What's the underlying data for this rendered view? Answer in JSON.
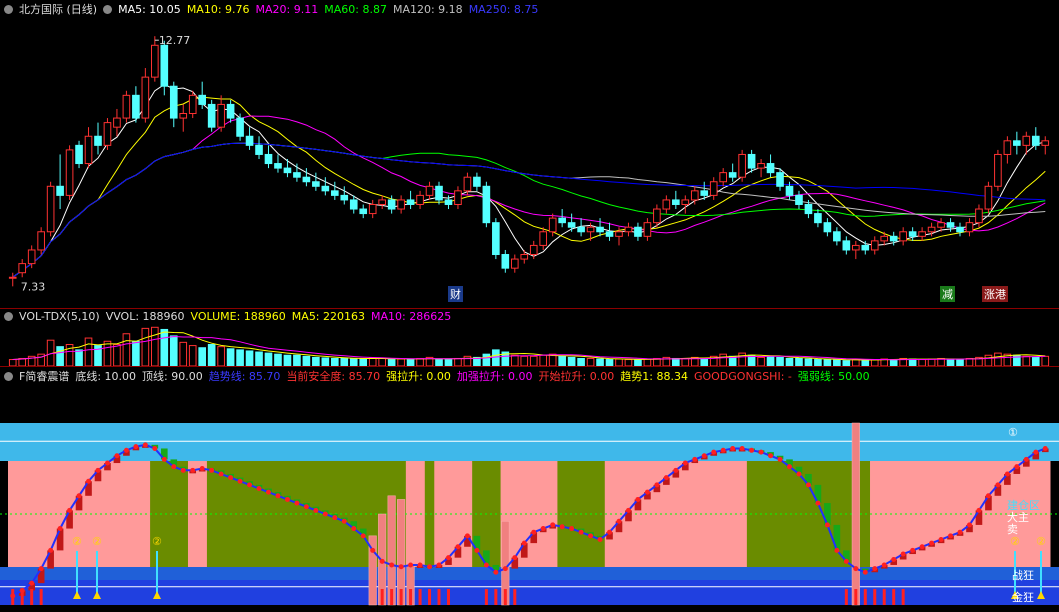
{
  "colors": {
    "up": "#ff3232",
    "down": "#54ffff",
    "ma5": "#ffffff",
    "ma10": "#ffff00",
    "ma20": "#ff00ff",
    "ma60": "#00ff00",
    "ma120": "#c0c0c0",
    "ma250": "#0000ff"
  },
  "price_panel": {
    "title": "北方国际 (日线)",
    "ma": [
      {
        "label": "MA5:",
        "value": "10.05",
        "color": "#ffffff"
      },
      {
        "label": "MA10:",
        "value": "9.76",
        "color": "#ffff00"
      },
      {
        "label": "MA20:",
        "value": "9.11",
        "color": "#ff00ff"
      },
      {
        "label": "MA60:",
        "value": "8.87",
        "color": "#00ff00"
      },
      {
        "label": "MA120:",
        "value": "9.18",
        "color": "#c0c0c0"
      },
      {
        "label": "MA250:",
        "value": "8.75",
        "color": "#3a3aff"
      }
    ],
    "high_label": "12.77",
    "low_label": "7.33",
    "markers": [
      {
        "text": "财",
        "color": "#ffffff",
        "bg": "#1a3a8a"
      },
      {
        "text": "减",
        "color": "#ffffff",
        "bg": "#1a7a1a"
      },
      {
        "text": "涨港",
        "color": "#ffffff",
        "bg": "#8a1a1a"
      }
    ]
  },
  "volume_panel": {
    "name": "VOL-TDX(5,10)",
    "items": [
      {
        "label": "VVOL:",
        "value": "188960",
        "color": "#dddddd"
      },
      {
        "label": "VOLUME:",
        "value": "188960",
        "color": "#ffff00"
      },
      {
        "label": "MA5:",
        "value": "220163",
        "color": "#ffff00"
      },
      {
        "label": "MA10:",
        "value": "286625",
        "color": "#ff00ff"
      }
    ]
  },
  "indicator_panel": {
    "name": "F简睿震谱",
    "items": [
      {
        "label": "底线:",
        "value": "10.00",
        "color": "#dddddd"
      },
      {
        "label": "顶线:",
        "value": "90.00",
        "color": "#dddddd"
      },
      {
        "label": "趋势线:",
        "value": "85.70",
        "color": "#3a3aff"
      },
      {
        "label": "当前安全度:",
        "value": "85.70",
        "color": "#ff3232"
      },
      {
        "label": "强拉升:",
        "value": "0.00",
        "color": "#ffff00"
      },
      {
        "label": "加强拉升:",
        "value": "0.00",
        "color": "#ff00ff"
      },
      {
        "label": "开始拉升:",
        "value": "0.00",
        "color": "#ff3232"
      },
      {
        "label": "趋势1:",
        "value": "88.34",
        "color": "#ffff00"
      },
      {
        "label": "GOODGONGSHI:",
        "value": "-",
        "color": "#ff3232"
      },
      {
        "label": "强弱线:",
        "value": "50.00",
        "color": "#00ff00"
      }
    ],
    "labels": {
      "circle1": "①",
      "circle2": "②",
      "zone": "建仓区",
      "main": "大主",
      "sell": "卖",
      "zhan": "战狂",
      "jin": "金狂"
    }
  },
  "chart_data": [
    {
      "type": "candlestick",
      "title": "北方国际 (日线)",
      "ylim": [
        7.0,
        13.2
      ],
      "annotations": [
        {
          "text": "12.77",
          "kind": "high"
        },
        {
          "text": "7.33",
          "kind": "low"
        }
      ],
      "candles": [
        [
          7.5,
          7.6,
          7.3,
          7.5
        ],
        [
          7.6,
          7.9,
          7.5,
          7.8
        ],
        [
          7.8,
          8.2,
          7.7,
          8.1
        ],
        [
          8.1,
          8.6,
          8.0,
          8.5
        ],
        [
          8.5,
          9.6,
          8.4,
          9.5
        ],
        [
          9.5,
          10.2,
          9.0,
          9.3
        ],
        [
          9.3,
          10.4,
          9.2,
          10.3
        ],
        [
          10.4,
          10.5,
          9.9,
          10.0
        ],
        [
          10.0,
          10.8,
          9.9,
          10.6
        ],
        [
          10.6,
          10.9,
          10.2,
          10.4
        ],
        [
          10.4,
          11.0,
          10.3,
          10.9
        ],
        [
          10.8,
          11.2,
          10.6,
          11.0
        ],
        [
          11.0,
          11.6,
          10.9,
          11.5
        ],
        [
          11.5,
          11.7,
          10.9,
          11.0
        ],
        [
          11.0,
          12.1,
          10.9,
          11.9
        ],
        [
          11.9,
          12.8,
          11.8,
          12.6
        ],
        [
          12.6,
          12.7,
          11.5,
          11.7
        ],
        [
          11.7,
          11.8,
          10.8,
          11.0
        ],
        [
          11.0,
          11.3,
          10.7,
          11.1
        ],
        [
          11.1,
          11.6,
          11.0,
          11.5
        ],
        [
          11.5,
          11.8,
          11.2,
          11.3
        ],
        [
          11.3,
          11.4,
          10.7,
          10.8
        ],
        [
          10.8,
          11.5,
          10.7,
          11.3
        ],
        [
          11.3,
          11.4,
          10.9,
          11.0
        ],
        [
          11.0,
          11.1,
          10.5,
          10.6
        ],
        [
          10.6,
          10.8,
          10.3,
          10.4
        ],
        [
          10.4,
          10.6,
          10.1,
          10.2
        ],
        [
          10.2,
          10.4,
          9.9,
          10.0
        ],
        [
          10.0,
          10.2,
          9.8,
          9.9
        ],
        [
          9.9,
          10.1,
          9.7,
          9.8
        ],
        [
          9.8,
          10.0,
          9.6,
          9.7
        ],
        [
          9.7,
          9.9,
          9.5,
          9.6
        ],
        [
          9.6,
          9.8,
          9.4,
          9.5
        ],
        [
          9.5,
          9.7,
          9.3,
          9.4
        ],
        [
          9.4,
          9.6,
          9.2,
          9.3
        ],
        [
          9.3,
          9.5,
          9.1,
          9.2
        ],
        [
          9.2,
          9.3,
          8.9,
          9.0
        ],
        [
          9.0,
          9.1,
          8.8,
          8.9
        ],
        [
          8.9,
          9.2,
          8.8,
          9.1
        ],
        [
          9.1,
          9.3,
          9.0,
          9.2
        ],
        [
          9.2,
          9.3,
          8.9,
          9.0
        ],
        [
          9.0,
          9.3,
          8.9,
          9.2
        ],
        [
          9.2,
          9.4,
          9.0,
          9.1
        ],
        [
          9.1,
          9.4,
          9.0,
          9.3
        ],
        [
          9.3,
          9.6,
          9.2,
          9.5
        ],
        [
          9.5,
          9.6,
          9.1,
          9.2
        ],
        [
          9.2,
          9.3,
          9.0,
          9.1
        ],
        [
          9.1,
          9.5,
          9.0,
          9.4
        ],
        [
          9.4,
          9.8,
          9.3,
          9.7
        ],
        [
          9.7,
          9.8,
          9.4,
          9.5
        ],
        [
          9.5,
          9.6,
          8.6,
          8.7
        ],
        [
          8.7,
          8.8,
          7.9,
          8.0
        ],
        [
          8.0,
          8.1,
          7.6,
          7.7
        ],
        [
          7.7,
          8.0,
          7.6,
          7.9
        ],
        [
          7.9,
          8.1,
          7.8,
          8.0
        ],
        [
          8.0,
          8.3,
          7.9,
          8.2
        ],
        [
          8.2,
          8.6,
          8.1,
          8.5
        ],
        [
          8.5,
          8.9,
          8.4,
          8.8
        ],
        [
          8.8,
          9.0,
          8.6,
          8.7
        ],
        [
          8.7,
          8.9,
          8.5,
          8.6
        ],
        [
          8.6,
          8.8,
          8.4,
          8.5
        ],
        [
          8.5,
          8.7,
          8.3,
          8.6
        ],
        [
          8.6,
          8.8,
          8.4,
          8.5
        ],
        [
          8.5,
          8.7,
          8.3,
          8.4
        ],
        [
          8.4,
          8.6,
          8.2,
          8.5
        ],
        [
          8.5,
          8.7,
          8.4,
          8.6
        ],
        [
          8.6,
          8.7,
          8.3,
          8.4
        ],
        [
          8.4,
          8.8,
          8.3,
          8.7
        ],
        [
          8.7,
          9.1,
          8.6,
          9.0
        ],
        [
          9.0,
          9.3,
          8.9,
          9.2
        ],
        [
          9.2,
          9.4,
          9.0,
          9.1
        ],
        [
          9.1,
          9.3,
          8.9,
          9.2
        ],
        [
          9.2,
          9.5,
          9.1,
          9.4
        ],
        [
          9.4,
          9.6,
          9.2,
          9.3
        ],
        [
          9.3,
          9.7,
          9.2,
          9.6
        ],
        [
          9.6,
          9.9,
          9.5,
          9.8
        ],
        [
          9.8,
          10.0,
          9.6,
          9.7
        ],
        [
          9.7,
          10.3,
          9.6,
          10.2
        ],
        [
          10.2,
          10.3,
          9.8,
          9.9
        ],
        [
          9.9,
          10.1,
          9.7,
          10.0
        ],
        [
          10.0,
          10.2,
          9.7,
          9.8
        ],
        [
          9.8,
          9.9,
          9.4,
          9.5
        ],
        [
          9.5,
          9.6,
          9.2,
          9.3
        ],
        [
          9.3,
          9.4,
          9.0,
          9.1
        ],
        [
          9.1,
          9.2,
          8.8,
          8.9
        ],
        [
          8.9,
          9.0,
          8.6,
          8.7
        ],
        [
          8.7,
          8.8,
          8.4,
          8.5
        ],
        [
          8.5,
          8.6,
          8.2,
          8.3
        ],
        [
          8.3,
          8.4,
          8.0,
          8.1
        ],
        [
          8.1,
          8.3,
          7.9,
          8.2
        ],
        [
          8.2,
          8.3,
          8.0,
          8.1
        ],
        [
          8.1,
          8.4,
          8.0,
          8.3
        ],
        [
          8.3,
          8.5,
          8.2,
          8.4
        ],
        [
          8.4,
          8.5,
          8.2,
          8.3
        ],
        [
          8.3,
          8.6,
          8.2,
          8.5
        ],
        [
          8.5,
          8.6,
          8.3,
          8.4
        ],
        [
          8.4,
          8.6,
          8.3,
          8.5
        ],
        [
          8.5,
          8.7,
          8.4,
          8.6
        ],
        [
          8.6,
          8.8,
          8.5,
          8.7
        ],
        [
          8.7,
          8.8,
          8.5,
          8.6
        ],
        [
          8.6,
          8.7,
          8.4,
          8.5
        ],
        [
          8.5,
          8.8,
          8.4,
          8.7
        ],
        [
          8.7,
          9.1,
          8.6,
          9.0
        ],
        [
          9.0,
          9.6,
          8.9,
          9.5
        ],
        [
          9.5,
          10.3,
          9.4,
          10.2
        ],
        [
          10.2,
          10.6,
          10.0,
          10.5
        ],
        [
          10.5,
          10.7,
          10.2,
          10.4
        ],
        [
          10.4,
          10.7,
          10.2,
          10.6
        ],
        [
          10.6,
          10.8,
          10.3,
          10.4
        ],
        [
          10.4,
          10.6,
          10.2,
          10.5
        ]
      ]
    },
    {
      "type": "bar",
      "title": "VOL-TDX(5,10)",
      "series": [
        {
          "name": "VOLUME",
          "values": [
            12,
            14,
            18,
            22,
            48,
            36,
            40,
            30,
            52,
            38,
            46,
            40,
            60,
            46,
            70,
            72,
            68,
            56,
            44,
            38,
            34,
            40,
            36,
            32,
            30,
            28,
            26,
            24,
            22,
            20,
            20,
            18,
            16,
            15,
            14,
            14,
            14,
            13,
            15,
            14,
            12,
            13,
            12,
            14,
            16,
            13,
            12,
            14,
            18,
            16,
            22,
            30,
            26,
            20,
            18,
            18,
            20,
            22,
            18,
            16,
            14,
            14,
            13,
            12,
            13,
            12,
            11,
            13,
            14,
            16,
            14,
            14,
            16,
            14,
            18,
            22,
            18,
            24,
            20,
            16,
            18,
            16,
            14,
            14,
            13,
            12,
            12,
            11,
            10,
            12,
            11,
            12,
            13,
            12,
            14,
            13,
            12,
            13,
            14,
            13,
            12,
            14,
            16,
            20,
            24,
            22,
            20,
            18,
            16,
            18
          ]
        }
      ],
      "ylim": [
        0,
        80
      ]
    },
    {
      "type": "line",
      "title": "F简睿震谱",
      "ylim": [
        0,
        100
      ],
      "series": [
        {
          "name": "当前安全度",
          "values": [
            5,
            8,
            12,
            20,
            30,
            42,
            52,
            60,
            68,
            74,
            78,
            82,
            85,
            87,
            88,
            86,
            80,
            76,
            74,
            74,
            75,
            74,
            72,
            70,
            68,
            66,
            64,
            62,
            60,
            58,
            56,
            54,
            52,
            50,
            48,
            46,
            42,
            38,
            30,
            24,
            22,
            21,
            22,
            22,
            21,
            22,
            26,
            32,
            38,
            30,
            22,
            18,
            20,
            26,
            34,
            40,
            42,
            44,
            43,
            42,
            40,
            38,
            36,
            40,
            46,
            52,
            58,
            62,
            66,
            70,
            74,
            78,
            80,
            82,
            84,
            85,
            86,
            86,
            85,
            84,
            82,
            80,
            76,
            72,
            66,
            56,
            44,
            30,
            24,
            20,
            18,
            20,
            22,
            25,
            28,
            30,
            32,
            34,
            36,
            38,
            40,
            44,
            52,
            60,
            66,
            72,
            76,
            80,
            84,
            86
          ]
        },
        {
          "name": "强拉升",
          "values": [
            0,
            0,
            0,
            0,
            0,
            0,
            0,
            0,
            0,
            0,
            0,
            0,
            0,
            0,
            0,
            0,
            0,
            0,
            0,
            0,
            0,
            0,
            0,
            0,
            0,
            0,
            0,
            0,
            0,
            0,
            0,
            0,
            0,
            0,
            0,
            0,
            0,
            0,
            38,
            50,
            60,
            58,
            22,
            0,
            0,
            0,
            0,
            0,
            0,
            0,
            0,
            0,
            46,
            0,
            0,
            0,
            0,
            0,
            0,
            0,
            0,
            0,
            0,
            0,
            0,
            0,
            0,
            0,
            0,
            0,
            0,
            0,
            0,
            0,
            0,
            0,
            0,
            0,
            0,
            0,
            0,
            0,
            0,
            0,
            0,
            0,
            0,
            0,
            0,
            100,
            0,
            0,
            0,
            0,
            0,
            0,
            0,
            0,
            0,
            0,
            0,
            0,
            0,
            0,
            0,
            0,
            0,
            0,
            0,
            0
          ]
        },
        {
          "name": "强弱线",
          "values": [
            50
          ]
        }
      ]
    }
  ]
}
